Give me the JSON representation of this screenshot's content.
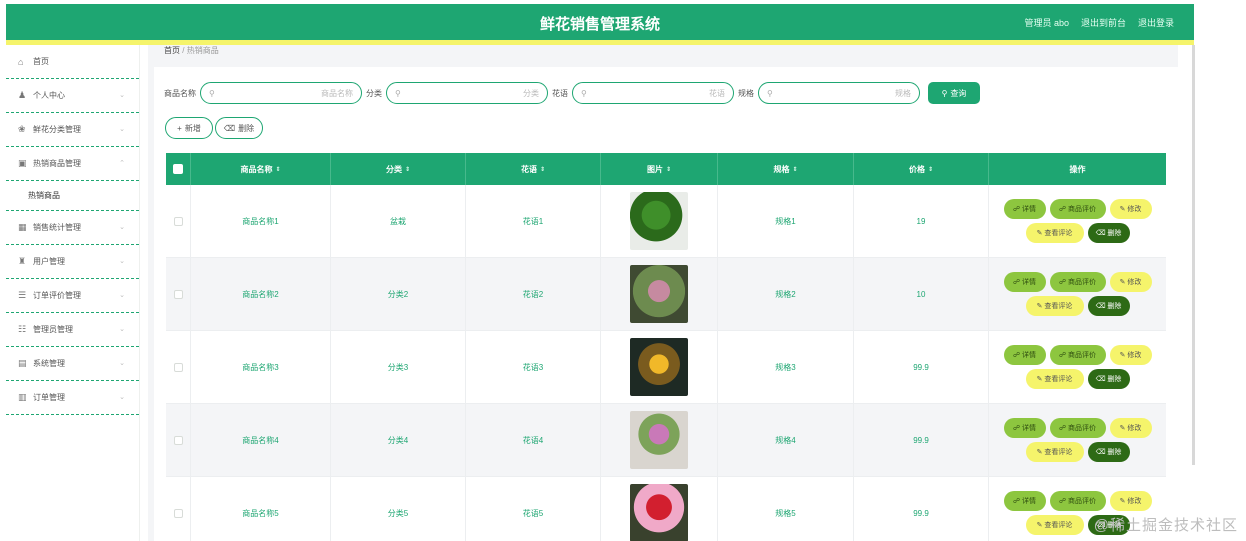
{
  "header": {
    "title": "鲜花销售管理系统",
    "admin": "管理员 abo",
    "links": [
      "退出到前台",
      "退出登录"
    ]
  },
  "breadcrumb": {
    "home": "首页",
    "separator": "/",
    "current": "热销商品"
  },
  "sidebar": {
    "items": [
      {
        "label": "首页",
        "icon": "home-icon",
        "glyph": "⌂"
      },
      {
        "label": "个人中心",
        "icon": "user-icon",
        "glyph": "♟"
      },
      {
        "label": "鲜花分类管理",
        "icon": "flower-icon",
        "glyph": "❀"
      },
      {
        "label": "热销商品管理",
        "icon": "goods-icon",
        "glyph": "▣"
      },
      {
        "label": "销售统计管理",
        "icon": "grid-icon",
        "glyph": "▦"
      },
      {
        "label": "用户管理",
        "icon": "users-icon",
        "glyph": "♜"
      },
      {
        "label": "订单评价管理",
        "icon": "list-icon",
        "glyph": "☰"
      },
      {
        "label": "管理员管理",
        "icon": "admin-icon",
        "glyph": "☷"
      },
      {
        "label": "系统管理",
        "icon": "system-icon",
        "glyph": "▤"
      },
      {
        "label": "订单管理",
        "icon": "order-icon",
        "glyph": "▥"
      }
    ],
    "submenu": "热销商品"
  },
  "search": {
    "fields": [
      {
        "label": "商品名称",
        "placeholder": "商品名称"
      },
      {
        "label": "分类",
        "placeholder": "分类"
      },
      {
        "label": "花语",
        "placeholder": "花语"
      },
      {
        "label": "规格",
        "placeholder": "规格"
      }
    ],
    "button": "查询"
  },
  "actions": {
    "add": "新增",
    "delete": "删除"
  },
  "table": {
    "columns": [
      "商品名称",
      "分类",
      "花语",
      "图片",
      "规格",
      "价格",
      "操作"
    ],
    "ops": {
      "detail": "详情",
      "review": "商品评价",
      "edit": "修改",
      "view_review": "查看评论",
      "delete": "删除"
    },
    "rows": [
      {
        "name": "商品名称1",
        "category": "盆栽",
        "language": "花语1",
        "spec": "规格1",
        "price": "19"
      },
      {
        "name": "商品名称2",
        "category": "分类2",
        "language": "花语2",
        "spec": "规格2",
        "price": "10"
      },
      {
        "name": "商品名称3",
        "category": "分类3",
        "language": "花语3",
        "spec": "规格3",
        "price": "99.9"
      },
      {
        "name": "商品名称4",
        "category": "分类4",
        "language": "花语4",
        "spec": "规格4",
        "price": "99.9"
      },
      {
        "name": "商品名称5",
        "category": "分类5",
        "language": "花语5",
        "spec": "规格5",
        "price": "99.9"
      }
    ]
  },
  "colors": {
    "primary": "#1ea672",
    "accent_yellow": "#f5f46b",
    "light_green": "#8dc63f",
    "dark_green": "#2d6a15"
  },
  "watermark": "@稀土掘金技术社区"
}
